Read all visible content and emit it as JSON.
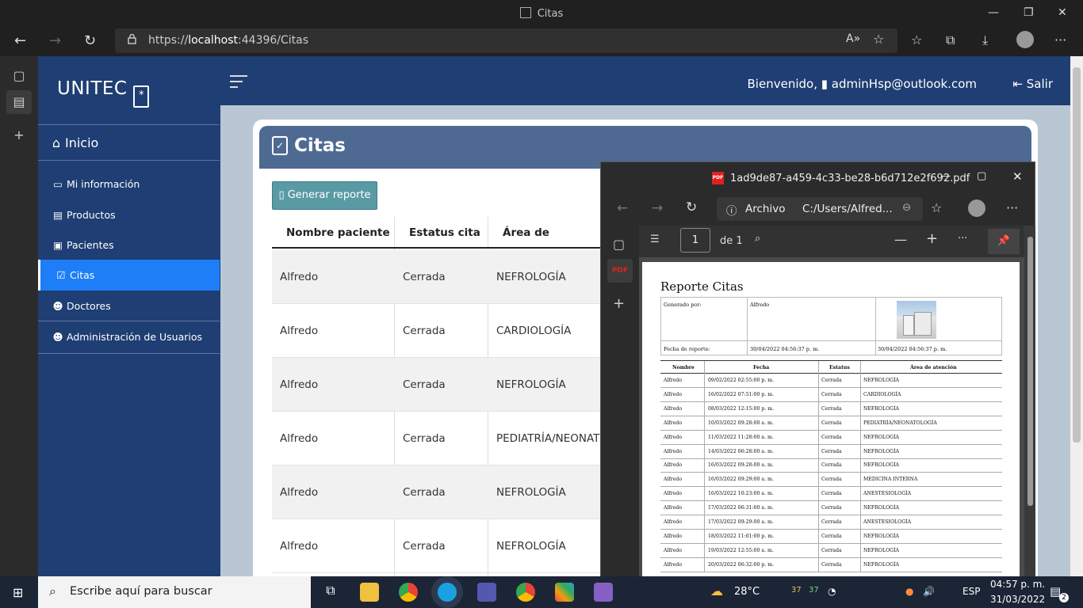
{
  "browser": {
    "window_title": "Citas",
    "url_prefix": "https://",
    "url_host": "localhost",
    "url_rest": ":44396/Citas"
  },
  "sidebar": {
    "brand": "UNITEC",
    "inicio": "Inicio",
    "items": [
      {
        "label": "Mi información",
        "icon": "id-card-icon"
      },
      {
        "label": "Productos",
        "icon": "box-icon"
      },
      {
        "label": "Pacientes",
        "icon": "user-badge-icon"
      },
      {
        "label": "Citas",
        "icon": "clipboard-check-icon"
      },
      {
        "label": "Doctores",
        "icon": "users-icon"
      },
      {
        "label": "Administración de Usuarios",
        "icon": "users-cog-icon"
      }
    ]
  },
  "topbar": {
    "welcome": "Bienvenido,",
    "user": "adminHsp@outlook.com",
    "logout": "Salir"
  },
  "main": {
    "title": "Citas",
    "generate_button": "Generar reporte",
    "columns": [
      "Nombre paciente",
      "Estatus cita",
      "Área de atención"
    ],
    "rows": [
      [
        "Alfredo",
        "Cerrada",
        "NEFROLOGÍA"
      ],
      [
        "Alfredo",
        "Cerrada",
        "CARDIOLOGÍA"
      ],
      [
        "Alfredo",
        "Cerrada",
        "NEFROLOGÍA"
      ],
      [
        "Alfredo",
        "Cerrada",
        "PEDIATRÍA/NEONATOLOGÍA"
      ],
      [
        "Alfredo",
        "Cerrada",
        "NEFROLOGÍA"
      ],
      [
        "Alfredo",
        "Cerrada",
        "NEFROLOGÍA"
      ]
    ]
  },
  "pdf_window": {
    "title": "1ad9de87-a459-4c33-be28-b6d712e2f692.pdf",
    "archivo": "Archivo",
    "path": "C:/Users/Alfred...",
    "page": "1",
    "of_pages": "de 1",
    "report": {
      "title": "Reporte Citas",
      "generado_label": "Generado por:",
      "generado_value": "Alfredo",
      "fecha_label": "Fecha de reporte:",
      "fecha_value": "30/04/2022 04:56:37 p. m.",
      "fecha_value2": "30/04/2022 04:56:37 p. m.",
      "headers": [
        "Nombre",
        "Fecha",
        "Estatus",
        "Área de atención"
      ],
      "rows": [
        [
          "Alfredo",
          "09/02/2022 02:55:00 p. m.",
          "Cerrada",
          "NEFROLOGÍA"
        ],
        [
          "Alfredo",
          "16/02/2022 07:51:00 p. m.",
          "Cerrada",
          "CARDIOLOGÍA"
        ],
        [
          "Alfredo",
          "08/03/2022 12:15:00 p. m.",
          "Cerrada",
          "NEFROLOGÍA"
        ],
        [
          "Alfredo",
          "10/03/2022 09:28:00 a. m.",
          "Cerrada",
          "PEDIATRÍA/NEONATOLOGÍA"
        ],
        [
          "Alfredo",
          "11/03/2022 11:28:00 a. m.",
          "Cerrada",
          "NEFROLOGÍA"
        ],
        [
          "Alfredo",
          "14/03/2022 06:28:00 a. m.",
          "Cerrada",
          "NEFROLOGÍA"
        ],
        [
          "Alfredo",
          "16/03/2022 09:28:00 a. m.",
          "Cerrada",
          "NEFROLOGÍA"
        ],
        [
          "Alfredo",
          "16/03/2022 09:29:00 a. m.",
          "Cerrada",
          "MEDICINA INTERNA"
        ],
        [
          "Alfredo",
          "16/03/2022 10:23:00 a. m.",
          "Cerrada",
          "ANESTESIOLOGÍA"
        ],
        [
          "Alfredo",
          "17/03/2022 06:31:00 a. m.",
          "Cerrada",
          "NEFROLOGÍA"
        ],
        [
          "Alfredo",
          "17/03/2022 09:29:00 a. m.",
          "Cerrada",
          "ANESTESIOLOGÍA"
        ],
        [
          "Alfredo",
          "18/03/2022 11:01:00 p. m.",
          "Cerrada",
          "NEFROLOGÍA"
        ],
        [
          "Alfredo",
          "19/03/2022 12:55:00 a. m.",
          "Cerrada",
          "NEFROLOGÍA"
        ],
        [
          "Alfredo",
          "20/03/2022 06:32:00 p. m.",
          "Cerrada",
          "NEFROLOGÍA"
        ]
      ]
    }
  },
  "taskbar": {
    "search_placeholder": "Escribe aquí para buscar",
    "weather": "28°C",
    "badge1": "37",
    "badge2": "37",
    "lang": "ESP",
    "time": "04:57 p. m.",
    "date": "31/03/2022",
    "notif": "2"
  },
  "colors": {
    "sidebar": "#1f3e73",
    "active": "#1d7ef7",
    "header": "#4e6a92",
    "button": "#5a9aa5"
  }
}
